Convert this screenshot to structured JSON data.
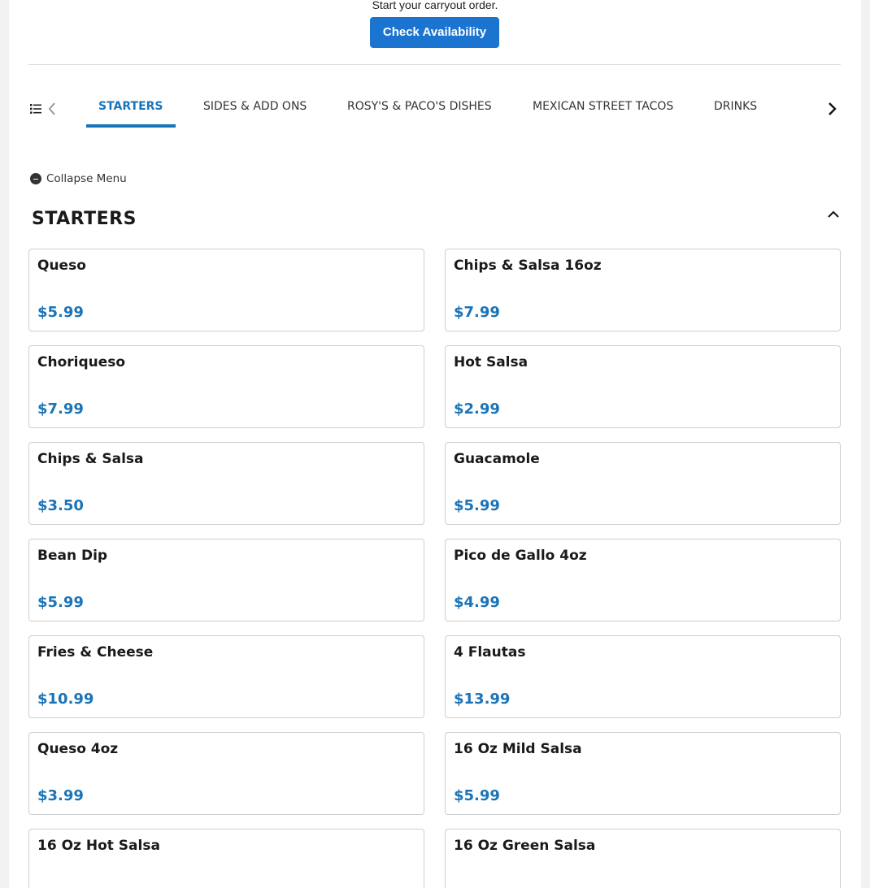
{
  "availability": {
    "message": "Start your carryout order.",
    "button_label": "Check Availability"
  },
  "category_nav": {
    "tabs": [
      {
        "label": "STARTERS",
        "active": true
      },
      {
        "label": "SIDES & ADD ONS",
        "active": false
      },
      {
        "label": "ROSY'S & PACO'S DISHES",
        "active": false
      },
      {
        "label": "MEXICAN STREET TACOS",
        "active": false
      },
      {
        "label": "DRINKS",
        "active": false
      }
    ],
    "accent_color": "#1a74b8"
  },
  "collapse_menu_label": "Collapse Menu",
  "section": {
    "title": "STARTERS",
    "items": [
      {
        "name": "Queso",
        "price": "$5.99"
      },
      {
        "name": "Chips & Salsa 16oz",
        "price": "$7.99"
      },
      {
        "name": "Choriqueso",
        "price": "$7.99"
      },
      {
        "name": "Hot Salsa",
        "price": "$2.99"
      },
      {
        "name": "Chips & Salsa",
        "price": "$3.50"
      },
      {
        "name": "Guacamole",
        "price": "$5.99"
      },
      {
        "name": "Bean Dip",
        "price": "$5.99"
      },
      {
        "name": "Pico de Gallo 4oz",
        "price": "$4.99"
      },
      {
        "name": "Fries & Cheese",
        "price": "$10.99"
      },
      {
        "name": "4 Flautas",
        "price": "$13.99"
      },
      {
        "name": "Queso 4oz",
        "price": "$3.99"
      },
      {
        "name": "16 Oz Mild Salsa",
        "price": "$5.99"
      },
      {
        "name": "16 Oz Hot Salsa",
        "price": ""
      },
      {
        "name": "16 Oz Green Salsa",
        "price": ""
      }
    ]
  },
  "icons": [
    "list-icon",
    "chevron-left-icon",
    "chevron-right-icon",
    "minus-circle-icon",
    "chevron-up-icon"
  ]
}
